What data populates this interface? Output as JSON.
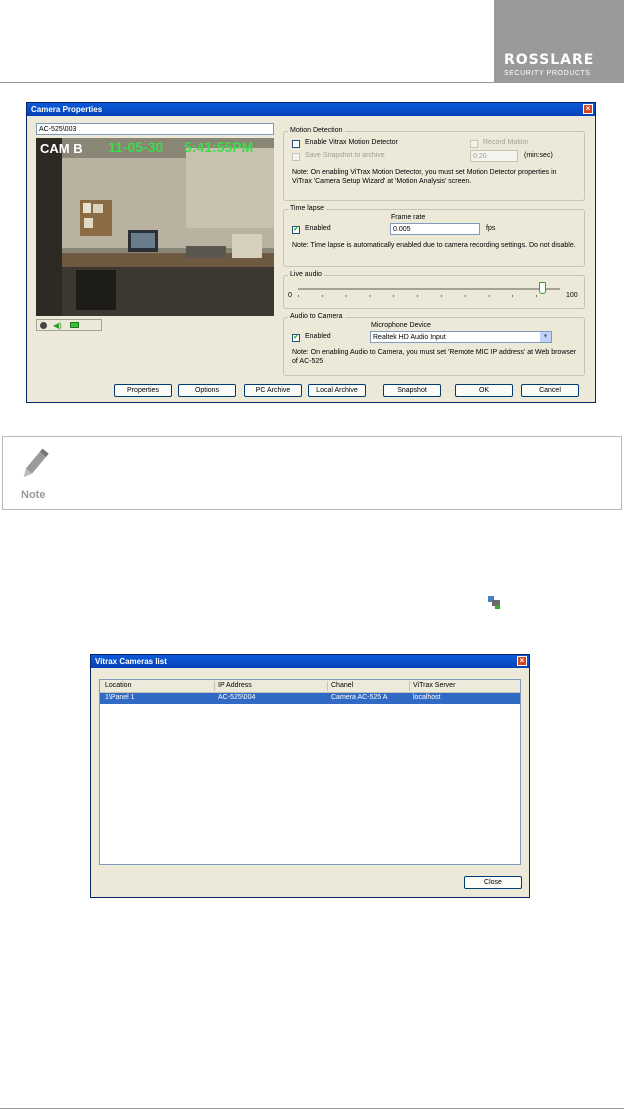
{
  "header": {
    "logo_text": "ROSSLARE",
    "logo_subtext": "SECURITY PRODUCTS"
  },
  "camera_properties": {
    "title": "Camera Properties",
    "camera_name": "AC-525\\003",
    "video_overlay": {
      "cam": "CAM B",
      "date": "11-05-30",
      "time": "5:41:55PM"
    },
    "motion_detection": {
      "title": "Motion Detection",
      "enable_label": "Enable Vitrax Motion Detector",
      "record_label": "Record Motion",
      "save_label": "Save Snapshot to archive",
      "interval_value": "0:20",
      "interval_unit": "(min:sec)",
      "note": "Note: On enabling ViTrax Motion Detector, you must set Motion Detector properties in ViTrax 'Camera Setup Wizard' at 'Motion Analysis' screen."
    },
    "time_lapse": {
      "title": "Time lapse",
      "enabled_label": "Enabled",
      "frame_rate_label": "Frame rate",
      "frame_rate_value": "0.005",
      "fps": "fps",
      "note": "Note: Time lapse is automatically enabled due to camera recording settings. Do not disable."
    },
    "live_audio": {
      "title": "Live audio",
      "min": "0",
      "max": "100",
      "level": 0.93
    },
    "audio_to_camera": {
      "title": "Audio to Camera",
      "enabled_label": "Enabled",
      "mic_label": "Microphone Device",
      "mic_value": "Realtek HD Audio Input",
      "note": "Note: On enabling Audio to Camera, you must set 'Remote MIC IP address' at Web browser of AC-525"
    },
    "buttons": {
      "properties": "Properties",
      "options": "Options",
      "pc_archive": "PC Archive",
      "local_archive": "Local Archive",
      "snapshot": "Snapshot",
      "ok": "OK",
      "cancel": "Cancel"
    }
  },
  "note_box": {
    "label": "Note"
  },
  "cameras_list": {
    "title": "Vitrax Cameras list",
    "columns": [
      "Location",
      "IP Address",
      "Chanel",
      "ViTrax Server"
    ],
    "rows": [
      [
        "1\\Panel 1",
        "AC-525\\004",
        "Camera AC-525 A",
        "localhost"
      ]
    ],
    "close": "Close"
  },
  "colors": {
    "titlebar": "#0541b8",
    "selection": "#316ac5",
    "logo_bg": "#9a9a9a"
  }
}
